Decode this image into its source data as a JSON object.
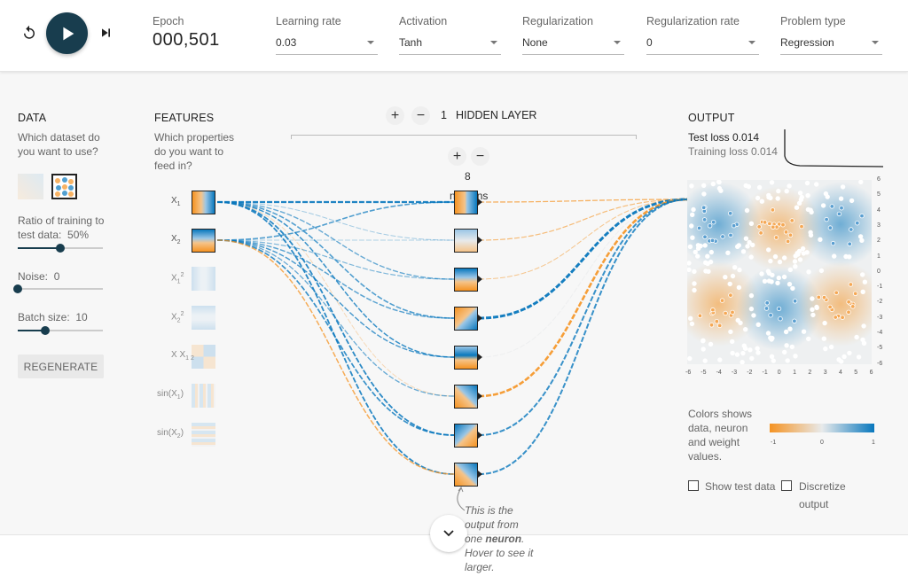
{
  "controls": {
    "epoch_label": "Epoch",
    "epoch_value": "000,501",
    "learning_rate": {
      "label": "Learning rate",
      "value": "0.03"
    },
    "activation": {
      "label": "Activation",
      "value": "Tanh"
    },
    "regularization": {
      "label": "Regularization",
      "value": "None"
    },
    "regularization_rate": {
      "label": "Regularization rate",
      "value": "0"
    },
    "problem_type": {
      "label": "Problem type",
      "value": "Regression"
    }
  },
  "data_panel": {
    "title": "DATA",
    "question": "Which dataset do you want to use?",
    "ratio_label": "Ratio of training to test data:",
    "ratio_value": "50%",
    "ratio_fraction": 0.5,
    "noise_label": "Noise:",
    "noise_value": "0",
    "noise_fraction": 0,
    "batch_label": "Batch size:",
    "batch_value": "10",
    "batch_fraction": 0.32,
    "regenerate_label": "REGENERATE"
  },
  "features_panel": {
    "title": "FEATURES",
    "question": "Which properties do you want to feed in?",
    "features": [
      {
        "label": "X",
        "sub": "1",
        "sup": "",
        "active": true
      },
      {
        "label": "X",
        "sub": "2",
        "sup": "",
        "active": true
      },
      {
        "label": "X",
        "sub": "1",
        "sup": "2",
        "active": false
      },
      {
        "label": "X",
        "sub": "2",
        "sup": "2",
        "active": false
      },
      {
        "label": "X X",
        "sub": "1  2",
        "sup": "",
        "active": false
      },
      {
        "label": "sin(X",
        "sub": "1",
        "sup": "",
        "tail": ")",
        "active": false
      },
      {
        "label": "sin(X",
        "sub": "2",
        "sup": "",
        "tail": ")",
        "active": false
      }
    ]
  },
  "hidden_layers": {
    "count": "1",
    "title": "HIDDEN LAYER",
    "plus": "+",
    "minus": "−",
    "neurons_count": "8",
    "neurons_label": "neurons"
  },
  "output_panel": {
    "title": "OUTPUT",
    "test_loss_label": "Test loss",
    "test_loss_value": "0.014",
    "training_loss_label": "Training loss",
    "training_loss_value": "0.014",
    "y_ticks": [
      "6",
      "5",
      "4",
      "3",
      "2",
      "1",
      "0",
      "-1",
      "-2",
      "-3",
      "-4",
      "-5",
      "-6"
    ],
    "x_ticks": [
      "-6",
      "-5",
      "-4",
      "-3",
      "-2",
      "-1",
      "0",
      "1",
      "2",
      "3",
      "4",
      "5",
      "6"
    ],
    "legend_text": "Colors shows data, neuron and weight values.",
    "legend_ticks": [
      "-1",
      "0",
      "1"
    ],
    "show_test_data": "Show test data",
    "discretize": "Discretize",
    "discretize_2": "output",
    "colors": {
      "negative": "#f59322",
      "neutral": "#e8eaeb",
      "positive": "#0877bd"
    }
  },
  "callout": {
    "part1": "This is the output from one ",
    "bold": "neuron",
    "part2": ". Hover to see it larger."
  }
}
